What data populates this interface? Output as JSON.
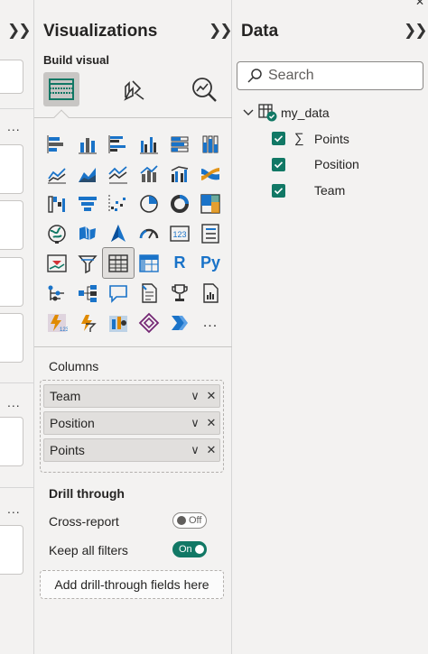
{
  "left_pane": {
    "collapse_icon": "double-chevron-right-icon",
    "more_label": "..."
  },
  "visualizations": {
    "title": "Visualizations",
    "collapse_icon": "double-chevron-right-icon",
    "build_label": "Build visual",
    "mode_tabs": [
      "build-visual-icon",
      "format-visual-icon",
      "analytics-icon"
    ],
    "visual_icons": [
      "stacked-bar-chart",
      "stacked-column-chart",
      "clustered-bar-chart",
      "clustered-column-chart",
      "100-stacked-bar-chart",
      "100-stacked-column-chart",
      "line-chart",
      "area-chart",
      "stacked-area-chart",
      "line-and-stacked-column-chart",
      "line-and-clustered-column-chart",
      "ribbon-chart",
      "waterfall-chart",
      "funnel-chart",
      "scatter-chart",
      "pie-chart",
      "donut-chart",
      "treemap",
      "map",
      "filled-map",
      "azure-map",
      "gauge",
      "card",
      "multi-row-card",
      "kpi",
      "slicer",
      "table",
      "matrix",
      "r-script-visual",
      "python-visual",
      "key-influencers",
      "decomposition-tree",
      "qna",
      "smart-narrative",
      "goals",
      "paginated-report",
      "power-apps",
      "power-automate",
      "metrics",
      "power-bi-apps",
      "chevron-visual",
      "more-visuals"
    ],
    "r_label": "R",
    "py_label": "Py",
    "more_label": "...",
    "columns_label": "Columns",
    "fields": [
      {
        "name": "Team"
      },
      {
        "name": "Position"
      },
      {
        "name": "Points"
      }
    ],
    "field_chevron": "∨",
    "field_remove": "✕",
    "drill_title": "Drill through",
    "cross_report": {
      "label": "Cross-report",
      "state": "Off"
    },
    "keep_filters": {
      "label": "Keep all filters",
      "state": "On"
    },
    "add_drill": "Add drill-through fields here"
  },
  "data_pane": {
    "title": "Data",
    "collapse_icon": "double-chevron-right-icon",
    "search_placeholder": "Search",
    "table_name": "my_data",
    "fields": [
      {
        "name": "Points",
        "sigma": "∑"
      },
      {
        "name": "Position",
        "sigma": ""
      },
      {
        "name": "Team",
        "sigma": ""
      }
    ]
  },
  "colors": {
    "accent": "#117865",
    "background": "#f3f2f1",
    "visual_blue": "#1a73c8",
    "selected": "#e1dfdd"
  }
}
